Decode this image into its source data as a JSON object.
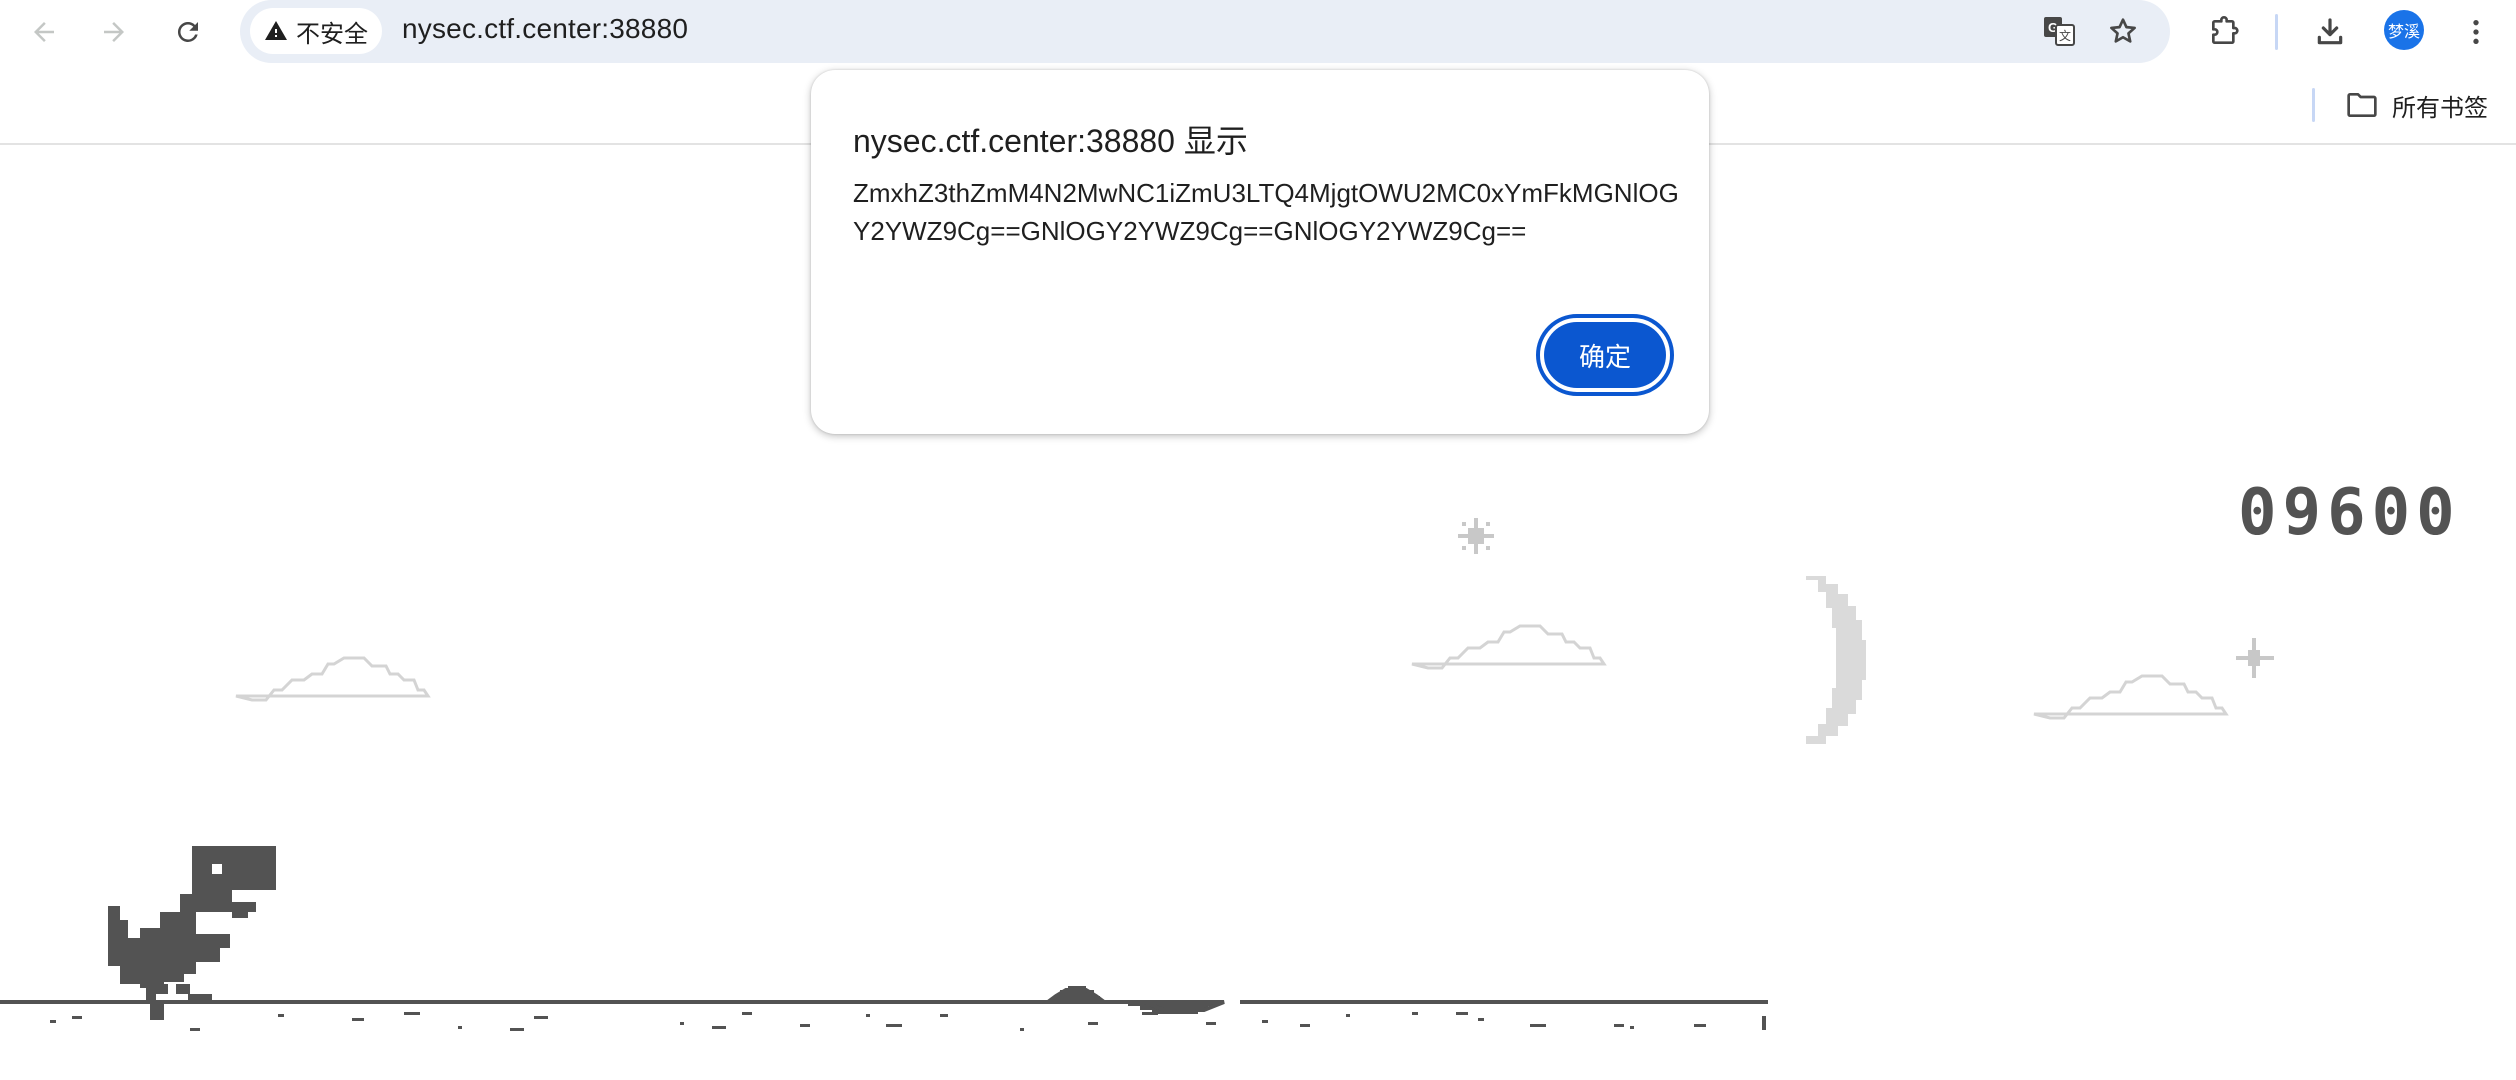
{
  "toolbar": {
    "back_icon": "arrow-left-icon",
    "forward_icon": "arrow-right-icon",
    "reload_icon": "reload-icon",
    "security_label": "不安全",
    "url": "nysec.ctf.center:38880",
    "avatar_text": "梦溪"
  },
  "bookmarks": {
    "all_bookmarks_label": "所有书签"
  },
  "game": {
    "score": "09600"
  },
  "dialog": {
    "title": "nysec.ctf.center:38880 显示",
    "message": "ZmxhZ3thZmM4N2MwNC1iZmU3LTQ4MjgtOWU2MC0xYmFkMGNlOGY2YWZ9Cg==GNlOGY2YWZ9Cg==GNlOGY2YWZ9Cg==",
    "ok_label": "确定"
  },
  "colors": {
    "accent": "#0b57d0",
    "omnibox_bg": "#e9eef6",
    "game_ink": "#535353",
    "night_sky_object": "#dadada"
  }
}
